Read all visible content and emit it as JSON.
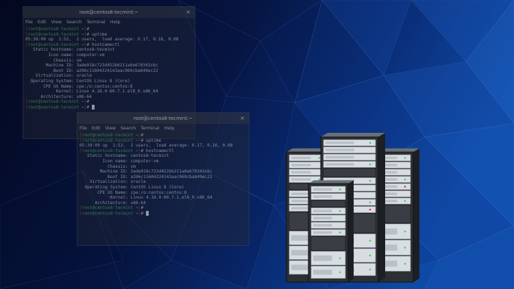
{
  "terminal_1": {
    "title": "root@centos8-tecmint:~",
    "close": "×",
    "menu": [
      "File",
      "Edit",
      "View",
      "Search",
      "Terminal",
      "Help"
    ],
    "prompt_user": "root@centos8-tecmint",
    "prompt_dir": "~",
    "cmd1": "uptime",
    "uptime_output": "05:38:09 up  1:52,  2 users,  load average: 0.17, 0.16, 0.08",
    "cmd2": "hostnamectl",
    "hostnamectl": [
      "   Static hostname: centos8-tecmint",
      "         Icon name: computer-vm",
      "           Chassis: vm",
      "        Machine ID: 3ade018c723d452b6211a0e670343c6c",
      "           Boot ID: a206c11604324143aac969cba649ec22",
      "    Virtualization: oracle",
      "  Operating System: CentOS Linux 8 (Core)",
      "       CPE OS Name: cpe:/o:centos:centos:8",
      "            Kernel: Linux 4.18.0-80.7.1.el8_0.x86_64",
      "      Architecture: x86-64"
    ]
  },
  "terminal_2": {
    "title": "root@centos8-tecmint:~",
    "close": "×",
    "menu": [
      "File",
      "Edit",
      "View",
      "Search",
      "Terminal",
      "Help"
    ],
    "prompt_user": "root@centos8-tecmint",
    "prompt_dir": "~",
    "cmd1": "uptime",
    "uptime_output": "05:38:09 up  1:52,  2 users,  load average: 0.17, 0.16, 0.08",
    "cmd2": "hostnamectl",
    "hostnamectl": [
      "   Static hostname: centos8-tecmint",
      "         Icon name: computer-vm",
      "           Chassis: vm",
      "        Machine ID: 3ade018c723d452b6211a0e670343c6c",
      "           Boot ID: a206c11604324143aac969cba649ec22",
      "    Virtualization: oracle",
      "  Operating System: CentOS Linux 8 (Core)",
      "       CPE OS Name: cpe:/o:centos:centos:8",
      "            Kernel: Linux 4.18.0-80.7.1.el8_0.x86_64",
      "      Architecture: x86-64"
    ]
  },
  "colors": {
    "background_dark": "#050c2a",
    "background_blue": "#0a3a8c",
    "rack_body": "#d8dde2",
    "rack_dark": "#2c2f33",
    "led_green": "#3ad05a",
    "led_red": "#d03040"
  },
  "illustration": "server-racks-icon"
}
